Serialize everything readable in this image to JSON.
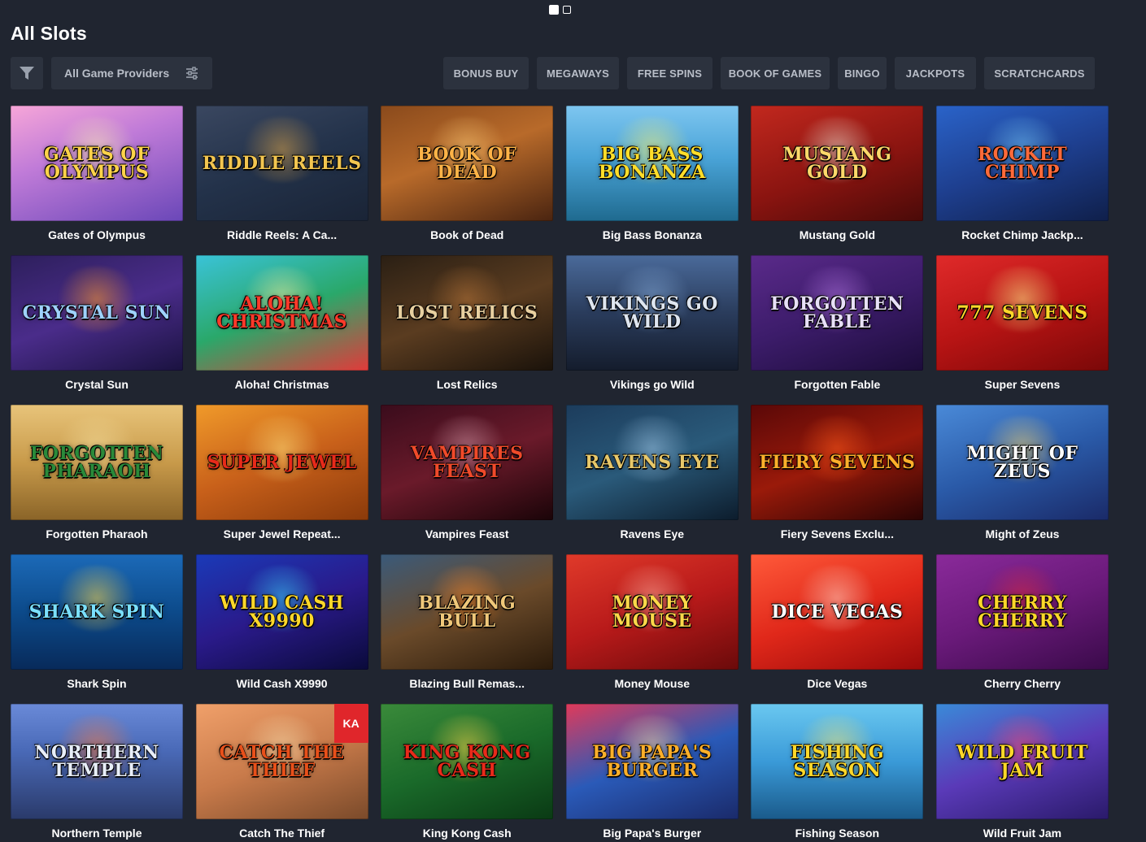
{
  "pager": {
    "count": 2,
    "active": 0
  },
  "title": "All Slots",
  "toolbar": {
    "filter_icon": "funnel-icon",
    "providers_label": "All Game Providers",
    "providers_icon": "sliders-icon",
    "chips": [
      "BONUS BUY",
      "MEGAWAYS",
      "FREE SPINS",
      "BOOK OF GAMES",
      "BINGO",
      "JACKPOTS",
      "SCRATCHCARDS"
    ]
  },
  "games": [
    {
      "title": "Gates of Olympus",
      "logo": "GATES OF OLYMPUS",
      "bg": "linear-gradient(160deg,#f7a6d8 0%,#c07bd8 40%,#6a47b8 100%)",
      "logo_color": "#ffd34a",
      "glow": "#fff3b0"
    },
    {
      "title": "Riddle Reels: A Ca...",
      "logo": "RIDDLE REELS",
      "bg": "linear-gradient(160deg,#3a4760 0%,#23324a 50%,#1a2436 100%)",
      "logo_color": "#f3c650",
      "glow": "#d9a34a"
    },
    {
      "title": "Book of Dead",
      "logo": "BOOK OF DEAD",
      "bg": "linear-gradient(160deg,#8a4a1c 0%,#b86a2a 45%,#4a2410 100%)",
      "logo_color": "#ffb347",
      "glow": "#ffcf7a"
    },
    {
      "title": "Big Bass Bonanza",
      "logo": "BIG BASS BONANZA",
      "bg": "linear-gradient(180deg,#7ec6f0 0%,#4aa4d8 45%,#1f6a8f 100%)",
      "logo_color": "#ffde2a",
      "glow": "#fff36a"
    },
    {
      "title": "Mustang Gold",
      "logo": "MUSTANG GOLD",
      "bg": "linear-gradient(160deg,#c2281e 0%,#8a1410 55%,#4a0a08 100%)",
      "logo_color": "#ffd86a",
      "glow": "#f2e8d8"
    },
    {
      "title": "Rocket Chimp Jackp...",
      "logo": "ROCKET CHIMP",
      "bg": "linear-gradient(160deg,#2a63c9 0%,#1e3f8f 50%,#0f1f4a 100%)",
      "logo_color": "#ff6a3a",
      "glow": "#7ad0ff"
    },
    {
      "title": "Crystal Sun",
      "logo": "CRYSTAL SUN",
      "bg": "linear-gradient(160deg,#2d1f5c 0%,#4a2c8a 50%,#1a1240 100%)",
      "logo_color": "#9fd2ff",
      "glow": "#ff9a2a"
    },
    {
      "title": "Aloha! Christmas",
      "logo": "ALOHA! CHRISTMAS",
      "bg": "linear-gradient(160deg,#3ac3d8 0%,#2aa86a 50%,#e23a3a 100%)",
      "logo_color": "#ff3a2a",
      "glow": "#fff0a0"
    },
    {
      "title": "Lost Relics",
      "logo": "LOST RELICS",
      "bg": "linear-gradient(160deg,#2a1f14 0%,#5a3c20 50%,#1a120a 100%)",
      "logo_color": "#e8d0a0",
      "glow": "#b8763a"
    },
    {
      "title": "Vikings go Wild",
      "logo": "VIKINGS GO WILD",
      "bg": "linear-gradient(180deg,#4a6a9a 0%,#2a3c5c 50%,#141c2c 100%)",
      "logo_color": "#dfe6f0",
      "glow": "#8ab0e0"
    },
    {
      "title": "Forgotten Fable",
      "logo": "FORGOTTEN FABLE",
      "bg": "linear-gradient(160deg,#5a2a8a 0%,#3c1c6a 50%,#1c0c3a 100%)",
      "logo_color": "#e8e0f8",
      "glow": "#b87ae8"
    },
    {
      "title": "Super Sevens",
      "logo": "777 SEVENS",
      "bg": "linear-gradient(160deg,#e02a2a 0%,#b81414 50%,#7a0808 100%)",
      "logo_color": "#ffd82a",
      "glow": "#ffee8a"
    },
    {
      "title": "Forgotten Pharaoh",
      "logo": "FORGOTTEN PHARAOH",
      "bg": "linear-gradient(180deg,#e8c47a 0%,#c89a4a 50%,#8a6428 100%)",
      "logo_color": "#2a8a3a",
      "glow": "#f6e0a0"
    },
    {
      "title": "Super Jewel Repeat...",
      "logo": "SUPER JEWEL",
      "bg": "linear-gradient(160deg,#f09a2a 0%,#c8601a 50%,#8a3a0a 100%)",
      "logo_color": "#e82a1a",
      "glow": "#ffe07a"
    },
    {
      "title": "Vampires Feast",
      "logo": "VAMPIRES FEAST",
      "bg": "linear-gradient(160deg,#3a0c1c 0%,#6a1a2a 50%,#1a0408 100%)",
      "logo_color": "#f04a2a",
      "glow": "#d8a0b0"
    },
    {
      "title": "Ravens Eye",
      "logo": "RAVENS EYE",
      "bg": "linear-gradient(160deg,#1c3c5c 0%,#2a5a7a 50%,#0c1c2c 100%)",
      "logo_color": "#e8c86a",
      "glow": "#a0c8e8"
    },
    {
      "title": "Fiery Sevens Exclu...",
      "logo": "FIERY SEVENS",
      "bg": "linear-gradient(160deg,#5a0808 0%,#9a1a0a 50%,#2a0404 100%)",
      "logo_color": "#ffb02a",
      "glow": "#ff5a1a"
    },
    {
      "title": "Might of Zeus",
      "logo": "MIGHT OF ZEUS",
      "bg": "linear-gradient(160deg,#4a8ad8 0%,#2a5aa8 50%,#1a2a68 100%)",
      "logo_color": "#ffffff",
      "glow": "#ffd86a"
    },
    {
      "title": "Shark Spin",
      "logo": "SHARK SPIN",
      "bg": "linear-gradient(180deg,#1c6ab8 0%,#0c4a8a 50%,#082a5a 100%)",
      "logo_color": "#7ae0ff",
      "glow": "#ffd84a"
    },
    {
      "title": "Wild Cash X9990",
      "logo": "WILD CASH X9990",
      "bg": "linear-gradient(160deg,#1a3ab8 0%,#2a1a8a 50%,#0a0a3a 100%)",
      "logo_color": "#ffd82a",
      "glow": "#3ad8ff"
    },
    {
      "title": "Blazing Bull Remas...",
      "logo": "BLAZING BULL",
      "bg": "linear-gradient(160deg,#3a5a7a 0%,#6a4a2a 50%,#2a1a0a 100%)",
      "logo_color": "#f0c87a",
      "glow": "#ff8a2a"
    },
    {
      "title": "Money Mouse",
      "logo": "MONEY MOUSE",
      "bg": "linear-gradient(160deg,#e03a2a 0%,#b81a1a 50%,#6a0a0a 100%)",
      "logo_color": "#ffd84a",
      "glow": "#ffb0a0"
    },
    {
      "title": "Dice Vegas",
      "logo": "DICE VEGAS",
      "bg": "linear-gradient(160deg,#ff5a3a 0%,#e0281a 50%,#9a0a0a 100%)",
      "logo_color": "#ffffff",
      "glow": "#ffd0c0"
    },
    {
      "title": "Cherry Cherry",
      "logo": "CHERRY CHERRY",
      "bg": "linear-gradient(160deg,#8a2a9a 0%,#6a1a7a 50%,#3a0a4a 100%)",
      "logo_color": "#ffd82a",
      "glow": "#e02a3a"
    },
    {
      "title": "Northern Temple",
      "logo": "NORTHERN TEMPLE",
      "bg": "linear-gradient(180deg,#6a8ad8 0%,#4a6ab8 40%,#2a3a6a 100%)",
      "logo_color": "#e8eef8",
      "glow": "#ff7a3a"
    },
    {
      "title": "Catch The Thief",
      "logo": "CATCH THE THIEF",
      "bg": "linear-gradient(160deg,#f0a06a 0%,#c87a4a 50%,#7a4a2a 100%)",
      "logo_color": "#e8501a",
      "glow": "#f8e0b0",
      "badge": "KA"
    },
    {
      "title": "King Kong Cash",
      "logo": "KING KONG CASH",
      "bg": "linear-gradient(160deg,#3a8a3a 0%,#1a6a2a 50%,#0a3a14 100%)",
      "logo_color": "#e82a1a",
      "glow": "#ffd84a"
    },
    {
      "title": "Big Papa's Burger",
      "logo": "BIG PAPA'S BURGER",
      "bg": "linear-gradient(160deg,#e03a5a 0%,#2a5ab8 50%,#1a2a6a 100%)",
      "logo_color": "#ffb02a",
      "glow": "#ffe0a0"
    },
    {
      "title": "Fishing Season",
      "logo": "FISHING SEASON",
      "bg": "linear-gradient(180deg,#6ac8f0 0%,#3a9ad8 50%,#1a5a8a 100%)",
      "logo_color": "#ffd82a",
      "glow": "#ffe86a"
    },
    {
      "title": "Wild Fruit Jam",
      "logo": "WILD FRUIT JAM",
      "bg": "linear-gradient(160deg,#3a8ad8 0%,#5a3ab8 50%,#2a1a6a 100%)",
      "logo_color": "#ffd82a",
      "glow": "#ff4a6a"
    }
  ]
}
